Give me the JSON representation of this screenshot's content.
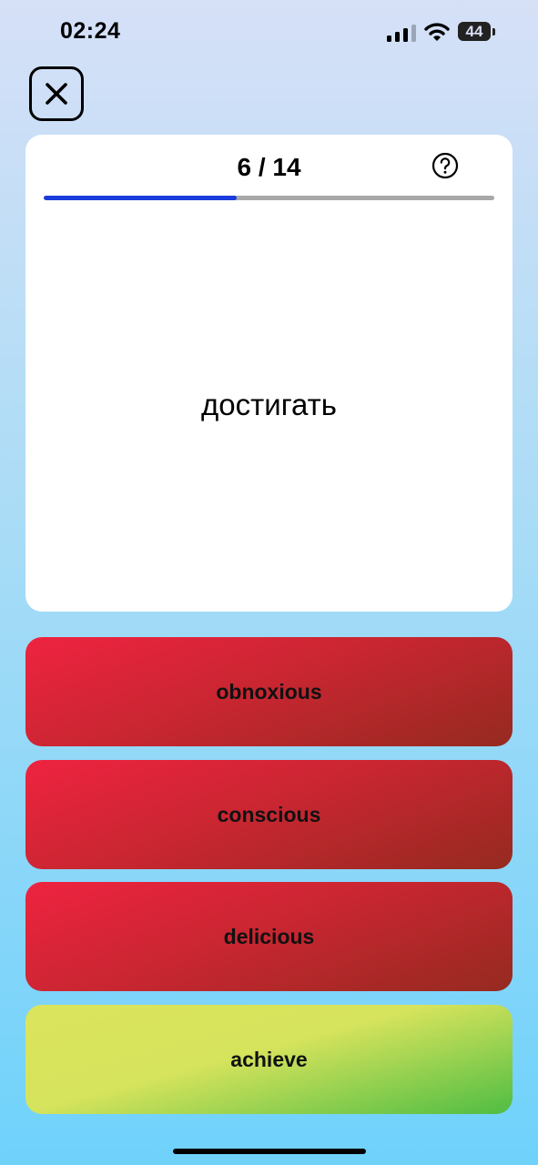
{
  "status_bar": {
    "time": "02:24",
    "battery_level": "44",
    "signal_bars_active": 3,
    "signal_bars_total": 4
  },
  "header": {
    "close_icon": "close-icon"
  },
  "card": {
    "progress_label": "6 / 14",
    "progress_fraction": 0.4286,
    "help_icon": "question-circle-icon",
    "word": "достигать"
  },
  "answers": [
    {
      "label": "obnoxious",
      "state": "wrong"
    },
    {
      "label": "conscious",
      "state": "wrong"
    },
    {
      "label": "delicious",
      "state": "wrong"
    },
    {
      "label": "achieve",
      "state": "correct"
    }
  ],
  "colors": {
    "progress_fill": "#1a3cdc",
    "progress_track": "#a8a8a8",
    "wrong": "#c62630",
    "correct": "#4fbd43"
  }
}
